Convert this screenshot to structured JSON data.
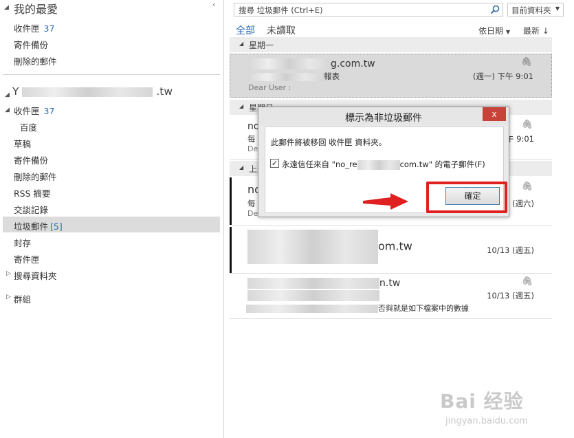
{
  "folder_pane": {
    "favorites_header": "我的最愛",
    "collapse_arrow": "‹",
    "favorites": [
      {
        "label": "收件匣",
        "count": "37"
      },
      {
        "label": "寄件備份",
        "count": ""
      },
      {
        "label": "刪除的郵件",
        "count": ""
      }
    ],
    "account_prefix": "Y",
    "account_suffix": ".tw",
    "inbox": {
      "label": "收件匣",
      "count": "37"
    },
    "inbox_sub": "百度",
    "folders": [
      {
        "label": "草稿",
        "count": ""
      },
      {
        "label": "寄件備份",
        "count": ""
      },
      {
        "label": "刪除的郵件",
        "count": ""
      },
      {
        "label": "RSS 摘要",
        "count": ""
      },
      {
        "label": "交談記錄",
        "count": ""
      },
      {
        "label": "垃圾郵件",
        "count": "[5]"
      },
      {
        "label": "封存",
        "count": ""
      },
      {
        "label": "寄件匣",
        "count": ""
      }
    ],
    "search_folders": "搜尋資料夾",
    "groups": "群組"
  },
  "search": {
    "placeholder": "搜尋 垃圾郵件 (Ctrl+E)",
    "scope": "目前資料夾"
  },
  "filters": {
    "all": "全部",
    "unread": "未讀取",
    "sort_by": "依日期",
    "order": "最新 ↓"
  },
  "groups": [
    {
      "label": "星期一"
    },
    {
      "label": "星期日"
    },
    {
      "label": "上週"
    }
  ],
  "messages": [
    {
      "sender_visible": "g.com.tw",
      "subject_visible": "報表",
      "preview": "Dear User :",
      "time": "(週一) 下午 9:01"
    },
    {
      "sender_visible": "no",
      "subject_visible": "每",
      "preview": "De",
      "time": "午 9:01"
    },
    {
      "sender_visible": "no",
      "subject_visible": "每",
      "preview": "De",
      "time": "(週六)"
    },
    {
      "sender_visible": "om.tw",
      "subject_visible": "",
      "preview": "",
      "time": "10/13 (週五)"
    },
    {
      "sender_visible": "n.tw",
      "subject_visible": "",
      "preview": "否與就是如下檔案中的數據",
      "time": "10/13 (週五)"
    }
  ],
  "dialog": {
    "title": "標示為非垃圾郵件",
    "close": "x",
    "message": "此郵件將被移回 收件匣 資料夾。",
    "checkbox_checked": "✓",
    "checkbox_label_start": "永遠信任來自 \"no_re",
    "checkbox_label_end": "com.tw\" 的電子郵件(F)",
    "ok": "確定"
  },
  "watermark": {
    "brand": "Bai  经验",
    "url": "jingyan.baidu.com"
  },
  "colors": {
    "accent": "#2a6bb8",
    "highlight": "#e02020"
  }
}
